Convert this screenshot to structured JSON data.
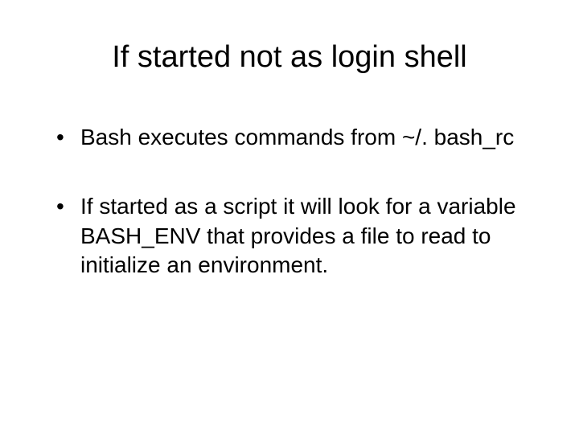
{
  "slide": {
    "title": "If started not as login shell",
    "bullets": [
      "Bash executes commands from ~/. bash_rc",
      "If started as a script it will look for a variable BASH_ENV that provides a file to read to initialize an environment."
    ]
  }
}
